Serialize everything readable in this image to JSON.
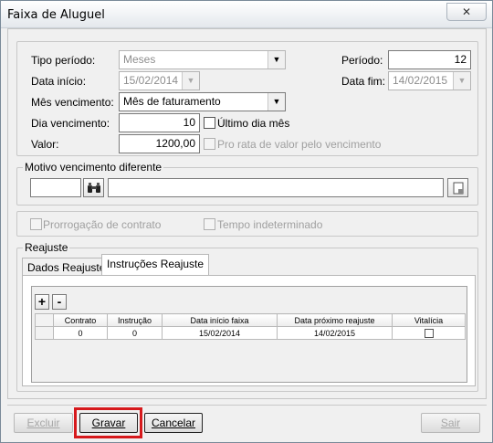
{
  "window": {
    "title": "Faixa de Aluguel",
    "close_symbol": "✕"
  },
  "form": {
    "tipo_periodo_label": "Tipo período:",
    "tipo_periodo_value": "Meses",
    "periodo_label": "Período:",
    "periodo_value": "12",
    "data_inicio_label": "Data início:",
    "data_inicio_value": "15/02/2014",
    "data_fim_label": "Data fim:",
    "data_fim_value": "14/02/2015",
    "mes_vencimento_label": "Mês vencimento:",
    "mes_vencimento_value": "Mês de faturamento",
    "dia_vencimento_label": "Dia vencimento:",
    "dia_vencimento_value": "10",
    "ultimo_dia_label": "Último dia mês",
    "valor_label": "Valor:",
    "valor_value": "1200,00",
    "pro_rata_label": "Pro rata de valor pelo vencimento"
  },
  "motivo": {
    "legend": "Motivo vencimento diferente",
    "code_value": "",
    "description_value": ""
  },
  "options": {
    "prorrogacao_label": "Prorrogação de contrato",
    "tempo_label": "Tempo indeterminado"
  },
  "reajuste": {
    "legend": "Reajuste",
    "tabs": [
      "Dados Reajuste",
      "Instruções Reajuste"
    ],
    "active_tab": "Instruções Reajuste",
    "add_label": "+",
    "remove_label": "-",
    "columns": [
      "Contrato",
      "Instrução",
      "Data início faixa",
      "Data próximo reajuste",
      "Vitalícia"
    ],
    "rows": [
      {
        "contrato": "0",
        "instrucao": "0",
        "data_inicio": "15/02/2014",
        "data_proximo": "14/02/2015",
        "vitalicia": false
      }
    ]
  },
  "buttons": {
    "excluir_label": "Excluir",
    "gravar_label": "Gravar",
    "cancelar_label": "Cancelar",
    "sair_label": "Sair"
  },
  "colors": {
    "highlight": "#d6191c"
  },
  "icons": {
    "search": "binoculars-icon",
    "lookup": "lookup-icon",
    "dropdown": "chevron-down-icon"
  }
}
